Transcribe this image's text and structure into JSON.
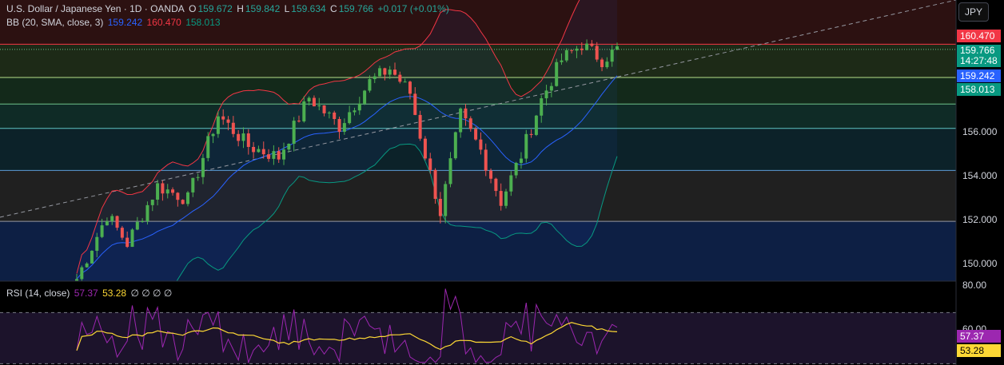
{
  "header": {
    "symbol": "U.S. Dollar / Japanese Yen · 1D · OANDA",
    "open_label": "O",
    "open": "159.672",
    "high_label": "H",
    "high": "159.842",
    "low_label": "L",
    "low": "159.634",
    "close_label": "C",
    "close": "159.766",
    "change": "+0.017 (+0.01%)"
  },
  "bb_legend": {
    "label": "BB (20, SMA, close, 3)",
    "basis": "159.242",
    "upper": "160.470",
    "lower": "158.013"
  },
  "rsi_legend": {
    "label": "RSI (14, close)",
    "rsi": "57.37",
    "ma": "53.28",
    "extra": "∅ ∅ ∅ ∅"
  },
  "currency_button": "JPY",
  "price_axis": {
    "ticks": [
      "156.000",
      "154.000",
      "152.000",
      "150.000"
    ],
    "tick_values": [
      156,
      154,
      152,
      150
    ],
    "badges": {
      "upper": "160.470",
      "last": "159.766",
      "countdown": "14:27:48",
      "basis": "159.242",
      "lower": "158.013"
    }
  },
  "rsi_axis": {
    "top_tick": "80.00",
    "partial_tick": "60.00",
    "rsi_badge": "57.37",
    "ma_badge": "53.28"
  },
  "colors": {
    "bull": "#4caf50",
    "bear": "#ef5350",
    "bb_upper": "#f23645",
    "bb_basis": "#2962ff",
    "bb_lower": "#089981",
    "rsi": "#9c27b0",
    "rsi_ma": "#fdd835"
  },
  "chart_data": {
    "type": "candlestick",
    "price_range": [
      149.3,
      162.0
    ],
    "bands": [
      {
        "from": 149.3,
        "to": 152.0,
        "color": "#0d1f44"
      },
      {
        "from": 152.0,
        "to": 154.3,
        "color": "#202020"
      },
      {
        "from": 154.3,
        "to": 156.2,
        "color": "#0c2229"
      },
      {
        "from": 156.2,
        "to": 157.3,
        "color": "#0f2b26"
      },
      {
        "from": 157.3,
        "to": 158.5,
        "color": "#13291a"
      },
      {
        "from": 158.5,
        "to": 160.0,
        "color": "#1d2a17"
      },
      {
        "from": 160.0,
        "to": 162.0,
        "color": "#2c1111"
      }
    ],
    "horizontal_lines": [
      152.0,
      154.3,
      156.2,
      157.3,
      158.5,
      160.0
    ],
    "dotted_line": 159.766,
    "rsi_range": [
      50,
      82
    ],
    "rsi_dashed_levels": [
      70,
      50.5
    ]
  }
}
